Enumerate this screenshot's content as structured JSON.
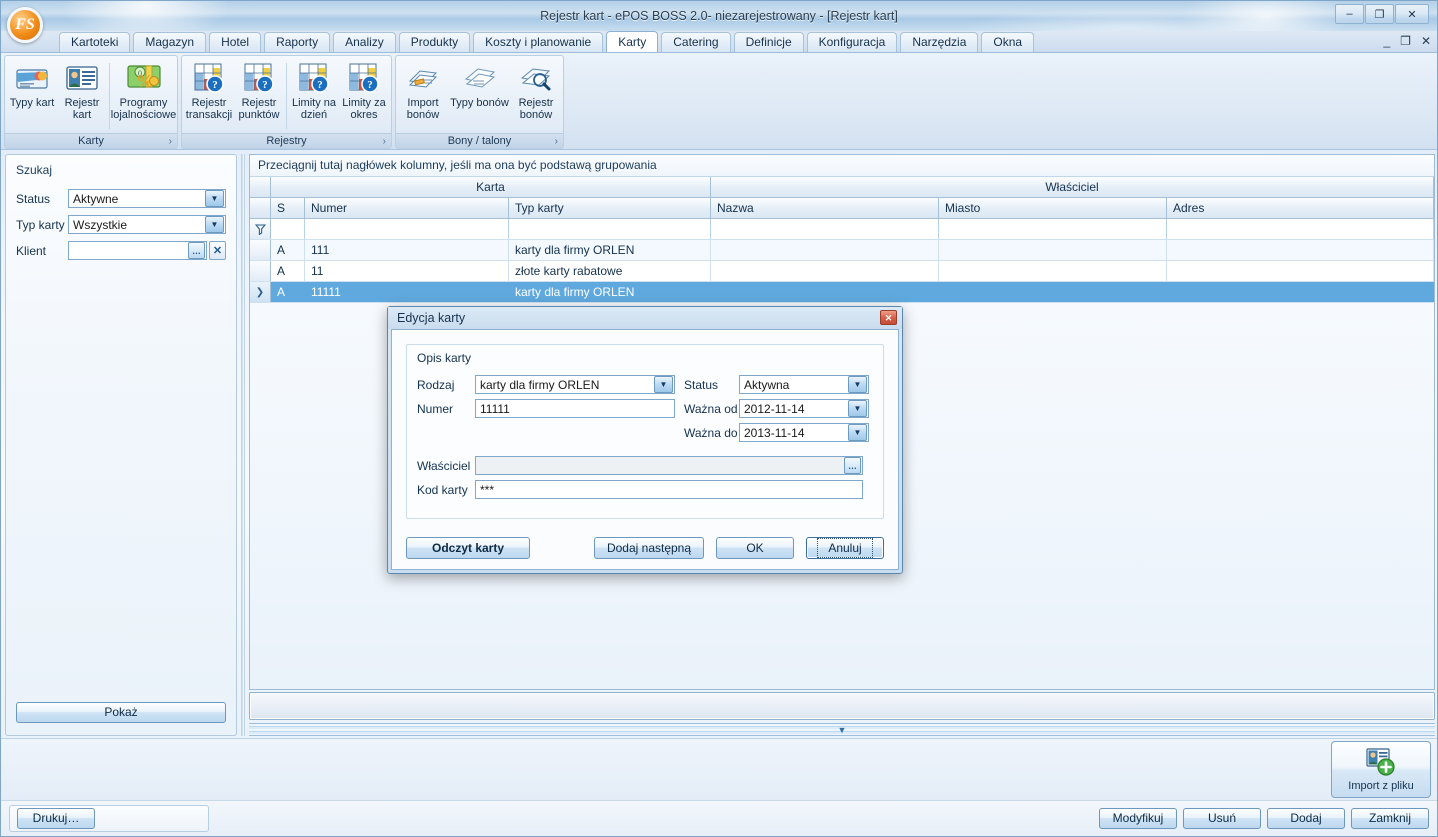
{
  "window": {
    "title": "Rejestr kart - ePOS BOSS 2.0- niezarejestrowany - [Rejestr kart]",
    "logo_text": "FS",
    "minimize": "–",
    "restore": "❐",
    "close": "✕"
  },
  "mdi": {
    "minimize": "_",
    "restore": "❐",
    "close": "✕"
  },
  "tabs": [
    {
      "label": "Kartoteki",
      "active": false
    },
    {
      "label": "Magazyn",
      "active": false
    },
    {
      "label": "Hotel",
      "active": false
    },
    {
      "label": "Raporty",
      "active": false
    },
    {
      "label": "Analizy",
      "active": false
    },
    {
      "label": "Produkty",
      "active": false
    },
    {
      "label": "Koszty i planowanie",
      "active": false
    },
    {
      "label": "Karty",
      "active": true
    },
    {
      "label": "Catering",
      "active": false
    },
    {
      "label": "Definicje",
      "active": false
    },
    {
      "label": "Konfiguracja",
      "active": false
    },
    {
      "label": "Narzędzia",
      "active": false
    },
    {
      "label": "Okna",
      "active": false
    }
  ],
  "ribbon": {
    "groups": [
      {
        "label": "Karty",
        "chevron": "›",
        "items": [
          {
            "label": "Typy kart",
            "icon": "card-types-icon"
          },
          {
            "label": "Rejestr kart",
            "icon": "card-register-icon"
          },
          {
            "label": "Programy lojalnościowe",
            "icon": "loyalty-programs-icon",
            "wide": true
          }
        ]
      },
      {
        "label": "Rejestry",
        "chevron": "›",
        "items": [
          {
            "label": "Rejestr transakcji",
            "icon": "transaction-register-icon"
          },
          {
            "label": "Rejestr punktów",
            "icon": "points-register-icon"
          },
          {
            "label": "Limity na dzień",
            "icon": "daily-limits-icon"
          },
          {
            "label": "Limity za okres",
            "icon": "period-limits-icon"
          }
        ]
      },
      {
        "label": "Bony / talony",
        "chevron": "›",
        "items": [
          {
            "label": "Import bonów",
            "icon": "voucher-import-icon"
          },
          {
            "label": "Typy bonów",
            "icon": "voucher-types-icon",
            "wide": true
          },
          {
            "label": "Rejestr bonów",
            "icon": "voucher-register-icon"
          }
        ]
      }
    ]
  },
  "search_panel": {
    "title": "Szukaj",
    "fields": [
      {
        "label": "Status",
        "value": "Aktywne",
        "control": "combo"
      },
      {
        "label": "Typ karty",
        "value": "Wszystkie",
        "control": "combo"
      },
      {
        "label": "Klient",
        "value": "",
        "control": "lookup"
      }
    ],
    "lookup_button": "…",
    "clear_button": "✕",
    "show_button": "Pokaż"
  },
  "grid": {
    "group_hint": "Przeciągnij tutaj nagłówek kolumny, jeśli ma ona być podstawą grupowania",
    "band_groups": [
      {
        "label": "Karta"
      },
      {
        "label": "Właściciel"
      }
    ],
    "columns": [
      {
        "label": "S"
      },
      {
        "label": "Numer"
      },
      {
        "label": "Typ karty"
      },
      {
        "label": "Nazwa"
      },
      {
        "label": "Miasto"
      },
      {
        "label": "Adres"
      }
    ],
    "filter_icon": "filter-funnel-icon",
    "selected_indicator": "❯",
    "rows": [
      {
        "s": "A",
        "numer": "111",
        "typ": "karty dla firmy ORLEN",
        "nazwa": "",
        "miasto": "",
        "adres": "",
        "selected": false
      },
      {
        "s": "A",
        "numer": "11",
        "typ": "złote karty rabatowe",
        "nazwa": "",
        "miasto": "",
        "adres": "",
        "selected": false
      },
      {
        "s": "A",
        "numer": "11111",
        "typ": "karty dla firmy ORLEN",
        "nazwa": "",
        "miasto": "",
        "adres": "",
        "selected": true
      }
    ]
  },
  "splitter": {
    "collapse_arrow": "▼"
  },
  "bottom": {
    "import_button": "Import z pliku",
    "import_icon": "import-user-add-icon"
  },
  "footbar": {
    "print_button": "Drukuj…",
    "actions": [
      "Modyfikuj",
      "Usuń",
      "Dodaj",
      "Zamknij"
    ]
  },
  "dialog": {
    "title": "Edycja karty",
    "close_icon": "✕",
    "legend": "Opis karty",
    "fields": {
      "rodzaj_label": "Rodzaj",
      "rodzaj_value": "karty dla firmy ORLEN",
      "status_label": "Status",
      "status_value": "Aktywna",
      "numer_label": "Numer",
      "numer_value": "11111",
      "wazna_od_label": "Ważna od",
      "wazna_od_value": "2012-11-14",
      "wazna_do_label": "Ważna do",
      "wazna_do_value": "2013-11-14",
      "wlasciciel_label": "Właściciel",
      "wlasciciel_value": "",
      "wlasciciel_browse": "…",
      "kod_label": "Kod karty",
      "kod_value": "***"
    },
    "buttons": {
      "read_card": "Odczyt karty",
      "add_next": "Dodaj następną",
      "ok": "OK",
      "cancel": "Anuluj"
    }
  },
  "colors": {
    "accent": "#5fa9de",
    "title_text": "#2c3e50",
    "close_red": "#c44b35",
    "logo_orange": "#f28c18"
  }
}
